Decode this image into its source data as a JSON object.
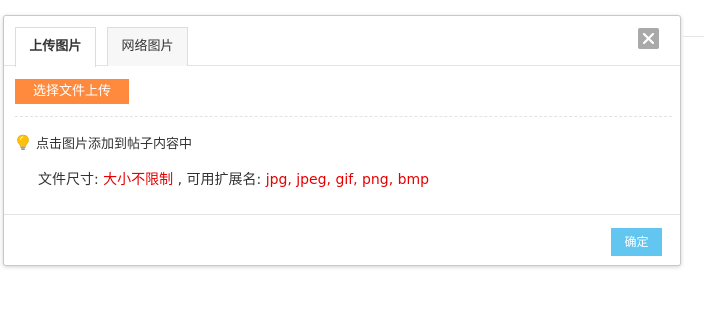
{
  "dialog": {
    "tabs": [
      {
        "label": "上传图片",
        "active": true
      },
      {
        "label": "网络图片",
        "active": false
      }
    ],
    "close_icon": "close-icon",
    "upload_button_label": "选择文件上传",
    "tip": {
      "icon": "lightbulb-icon",
      "text": "点击图片添加到帖子内容中"
    },
    "file_info": {
      "size_label": "文件尺寸: ",
      "size_value": "大小不限制",
      "sep_text": " , 可用扩展名: ",
      "extensions": "jpg, jpeg, gif, png, bmp"
    },
    "confirm_label": "确定"
  },
  "colors": {
    "upload_button": "#ff8a3d",
    "confirm_button": "#62c6f1",
    "highlight_red": "#e60000",
    "close_button": "#a9a9a9"
  }
}
